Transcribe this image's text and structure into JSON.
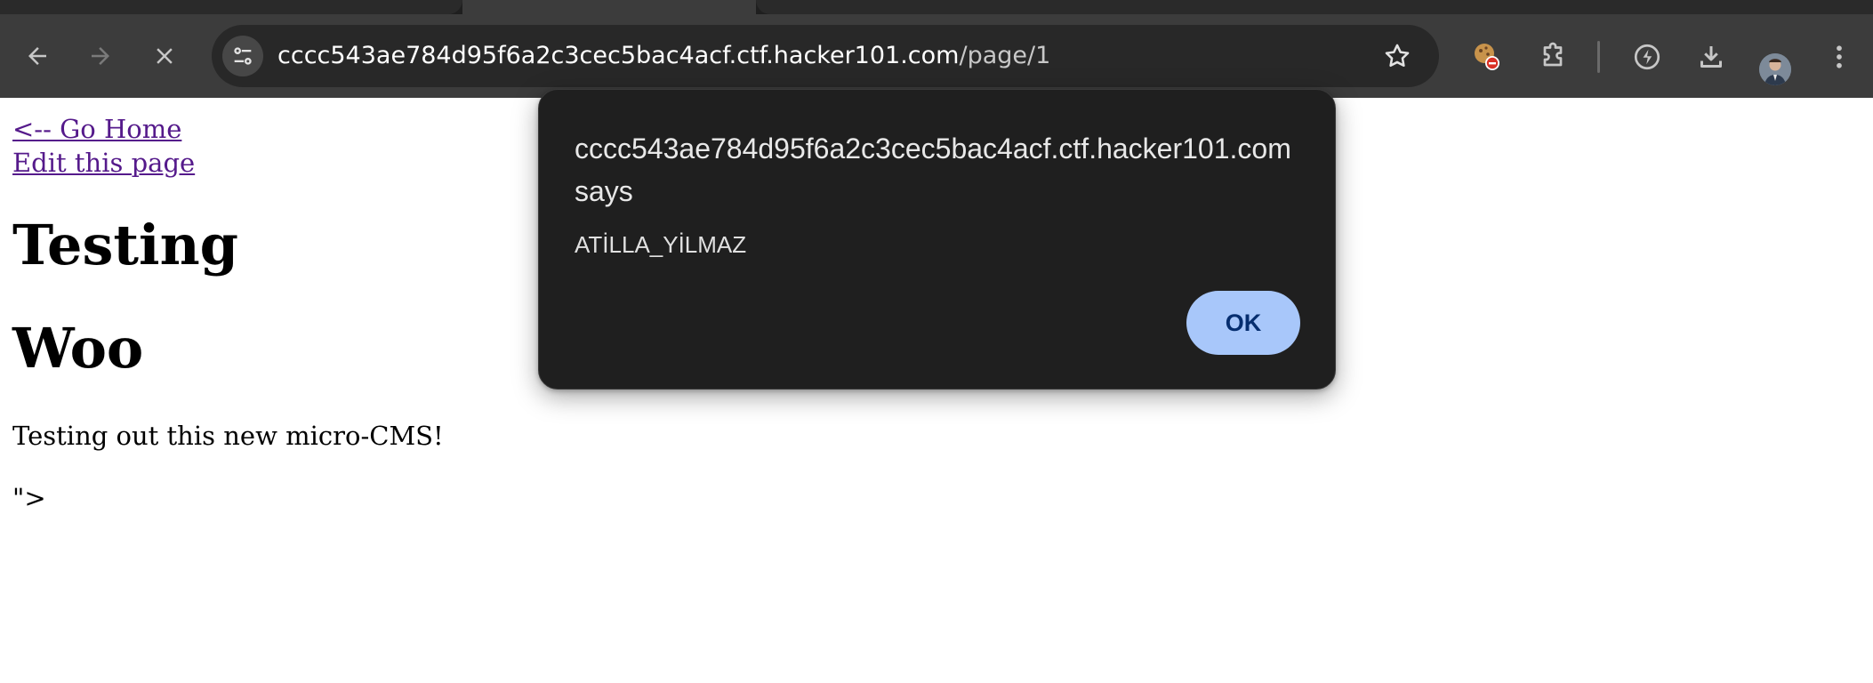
{
  "browser": {
    "address_bar": {
      "host": "cccc543ae784d95f6a2c3cec5bac4acf.ctf.hacker101.com",
      "path": "/page/1"
    },
    "icons": {
      "back": "back-arrow-icon",
      "forward": "forward-arrow-icon",
      "stop": "close-icon",
      "site_info": "tune-icon",
      "bookmark": "star-icon",
      "cookie_extension": "cookie-icon",
      "extensions": "puzzle-icon",
      "performance": "leaf-icon",
      "downloads": "download-icon",
      "menu": "kebab-menu-icon"
    }
  },
  "page": {
    "links": {
      "home": "<-- Go Home",
      "edit": "Edit this page"
    },
    "headings": [
      "Testing",
      "Woo"
    ],
    "body_text": "Testing out this new micro-CMS!",
    "trailing_text": "\">"
  },
  "alert": {
    "title": "cccc543ae784d95f6a2c3cec5bac4acf.ctf.hacker101.com says",
    "message": "ATİLLA_YİLMAZ",
    "ok_label": "OK"
  },
  "colors": {
    "toolbar": "#3c3c3c",
    "omnibox": "#282828",
    "dialog": "#1f1f1f",
    "ok_button": "#a8c7fa",
    "link_visited": "#551a8b"
  }
}
